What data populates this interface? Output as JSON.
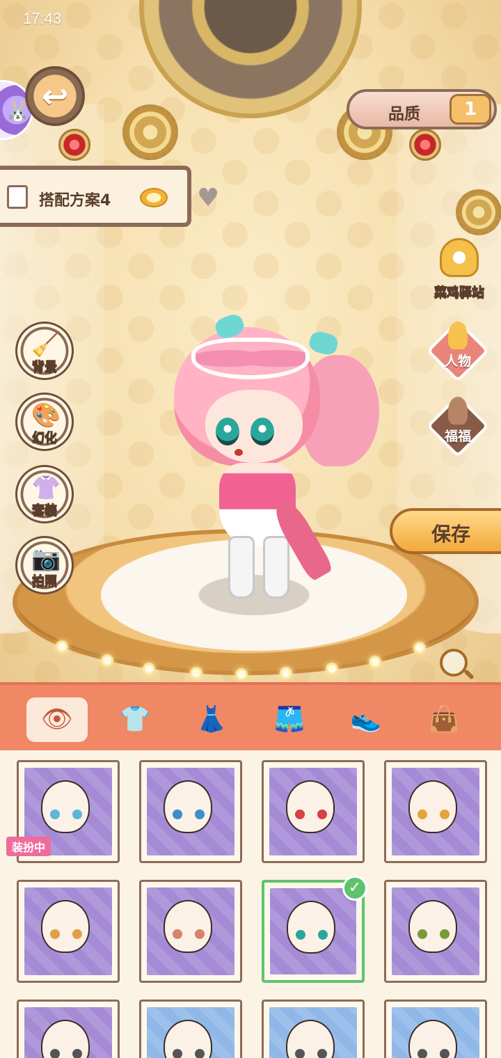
{
  "status_bar": {
    "time": "17:43"
  },
  "top": {
    "quality_label": "品质",
    "quality_icon": "1",
    "plan_label": "搭配方案4"
  },
  "left_menu": [
    {
      "label": "背景",
      "icon": "brush-icon"
    },
    {
      "label": "幻化",
      "icon": "palette-icon"
    },
    {
      "label": "套装",
      "icon": "outfit-icon"
    },
    {
      "label": "拍照",
      "icon": "camera-icon"
    }
  ],
  "right_menu": {
    "station_label": "菜鸡驿站",
    "character_label": "人物",
    "pet_label": "福福",
    "save_label": "保存"
  },
  "tabs": [
    {
      "name": "eyes",
      "icon": "eye-icon",
      "glyph": "👁",
      "active": true
    },
    {
      "name": "tops",
      "icon": "shirt-icon",
      "glyph": "👕",
      "active": false
    },
    {
      "name": "dresses",
      "icon": "dress-icon",
      "glyph": "👗",
      "active": false
    },
    {
      "name": "bottoms",
      "icon": "shorts-icon",
      "glyph": "🩳",
      "active": false
    },
    {
      "name": "shoes",
      "icon": "shoes-icon",
      "glyph": "👟",
      "active": false
    },
    {
      "name": "bags",
      "icon": "bag-icon",
      "glyph": "👜",
      "active": false
    }
  ],
  "wearing_badge": "装扮中",
  "items": [
    {
      "bg": "#a58bd6",
      "eye": "#5db6d9"
    },
    {
      "bg": "#a58bd6",
      "eye": "#3a8fc9"
    },
    {
      "bg": "#a58bd6",
      "eye": "#d44242"
    },
    {
      "bg": "#a58bd6",
      "eye": "#e3a43b"
    },
    {
      "bg": "#a58bd6",
      "eye": "#e0a04a"
    },
    {
      "bg": "#a58bd6",
      "eye": "#d8826e"
    },
    {
      "bg": "#a58bd6",
      "eye": "#2aa79b",
      "selected": true
    },
    {
      "bg": "#a58bd6",
      "eye": "#7a9a3a"
    },
    {
      "bg": "#a58bd6",
      "eye": "#555555"
    },
    {
      "bg": "#8fb8e8",
      "eye": "#555555"
    },
    {
      "bg": "#8fb8e8",
      "eye": "#555555"
    },
    {
      "bg": "#8fb8e8",
      "eye": "#555555"
    }
  ]
}
